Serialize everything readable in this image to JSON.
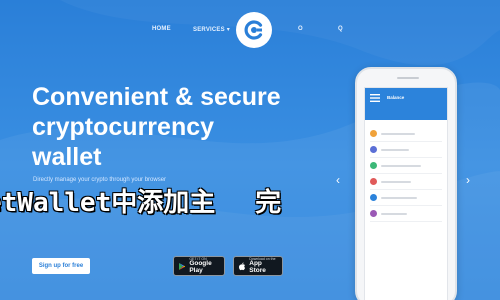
{
  "nav": {
    "home": "HOME",
    "services": "SERVICES",
    "right_1": "O",
    "right_2": "Q"
  },
  "logo": {
    "icon": "c-logo-icon"
  },
  "hero": {
    "title_line1": "Convenient & secure",
    "title_line2": "cryptocurrency",
    "title_line3": "wallet",
    "description": "Directly manage your crypto through your browser"
  },
  "overlay_text": "etWallet中添加主",
  "overlay_trailing": "完",
  "buttons": {
    "signup": "Sign up for free",
    "google_play_small": "GET IT ON",
    "google_play_big": "Google Play",
    "apple_small": "Download on the",
    "apple_big": "App Store"
  },
  "phone": {
    "screen_title": "Balance",
    "arrow_left": "‹",
    "arrow_right": "›"
  },
  "colors": {
    "background": "#2a7fd8",
    "button_text": "#2a7fd8",
    "store_button": "#111820"
  }
}
